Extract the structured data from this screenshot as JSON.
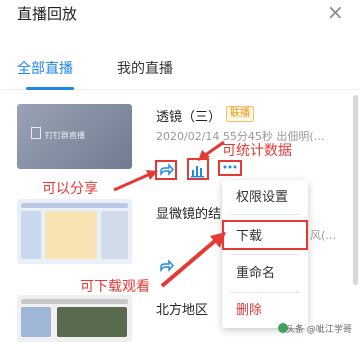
{
  "header": {
    "title": "直播回放",
    "close": "×"
  },
  "tabs": [
    {
      "label": "全部直播",
      "active": true
    },
    {
      "label": "我的直播",
      "active": false
    }
  ],
  "items": [
    {
      "title": "透镜（三）",
      "badge": "联播",
      "meta": "2020/02/14 55分45秒 出佃明(…",
      "thumb_label": "钉钉群直播"
    },
    {
      "title": "显微镜的结",
      "meta_suffix": "风(…"
    },
    {
      "title": "北方地区"
    }
  ],
  "menu": {
    "items": [
      "权限设置",
      "下载",
      "重命名",
      "删除"
    ],
    "delete_color": "#e53935"
  },
  "annotations": {
    "share": "可以分享",
    "stats": "可统计数据",
    "download": "可下载观看",
    "color": "#e53935"
  },
  "watermark": "头条 @呲江学哥",
  "colors": {
    "accent": "#1f88e5",
    "badge": "#e99a10"
  }
}
